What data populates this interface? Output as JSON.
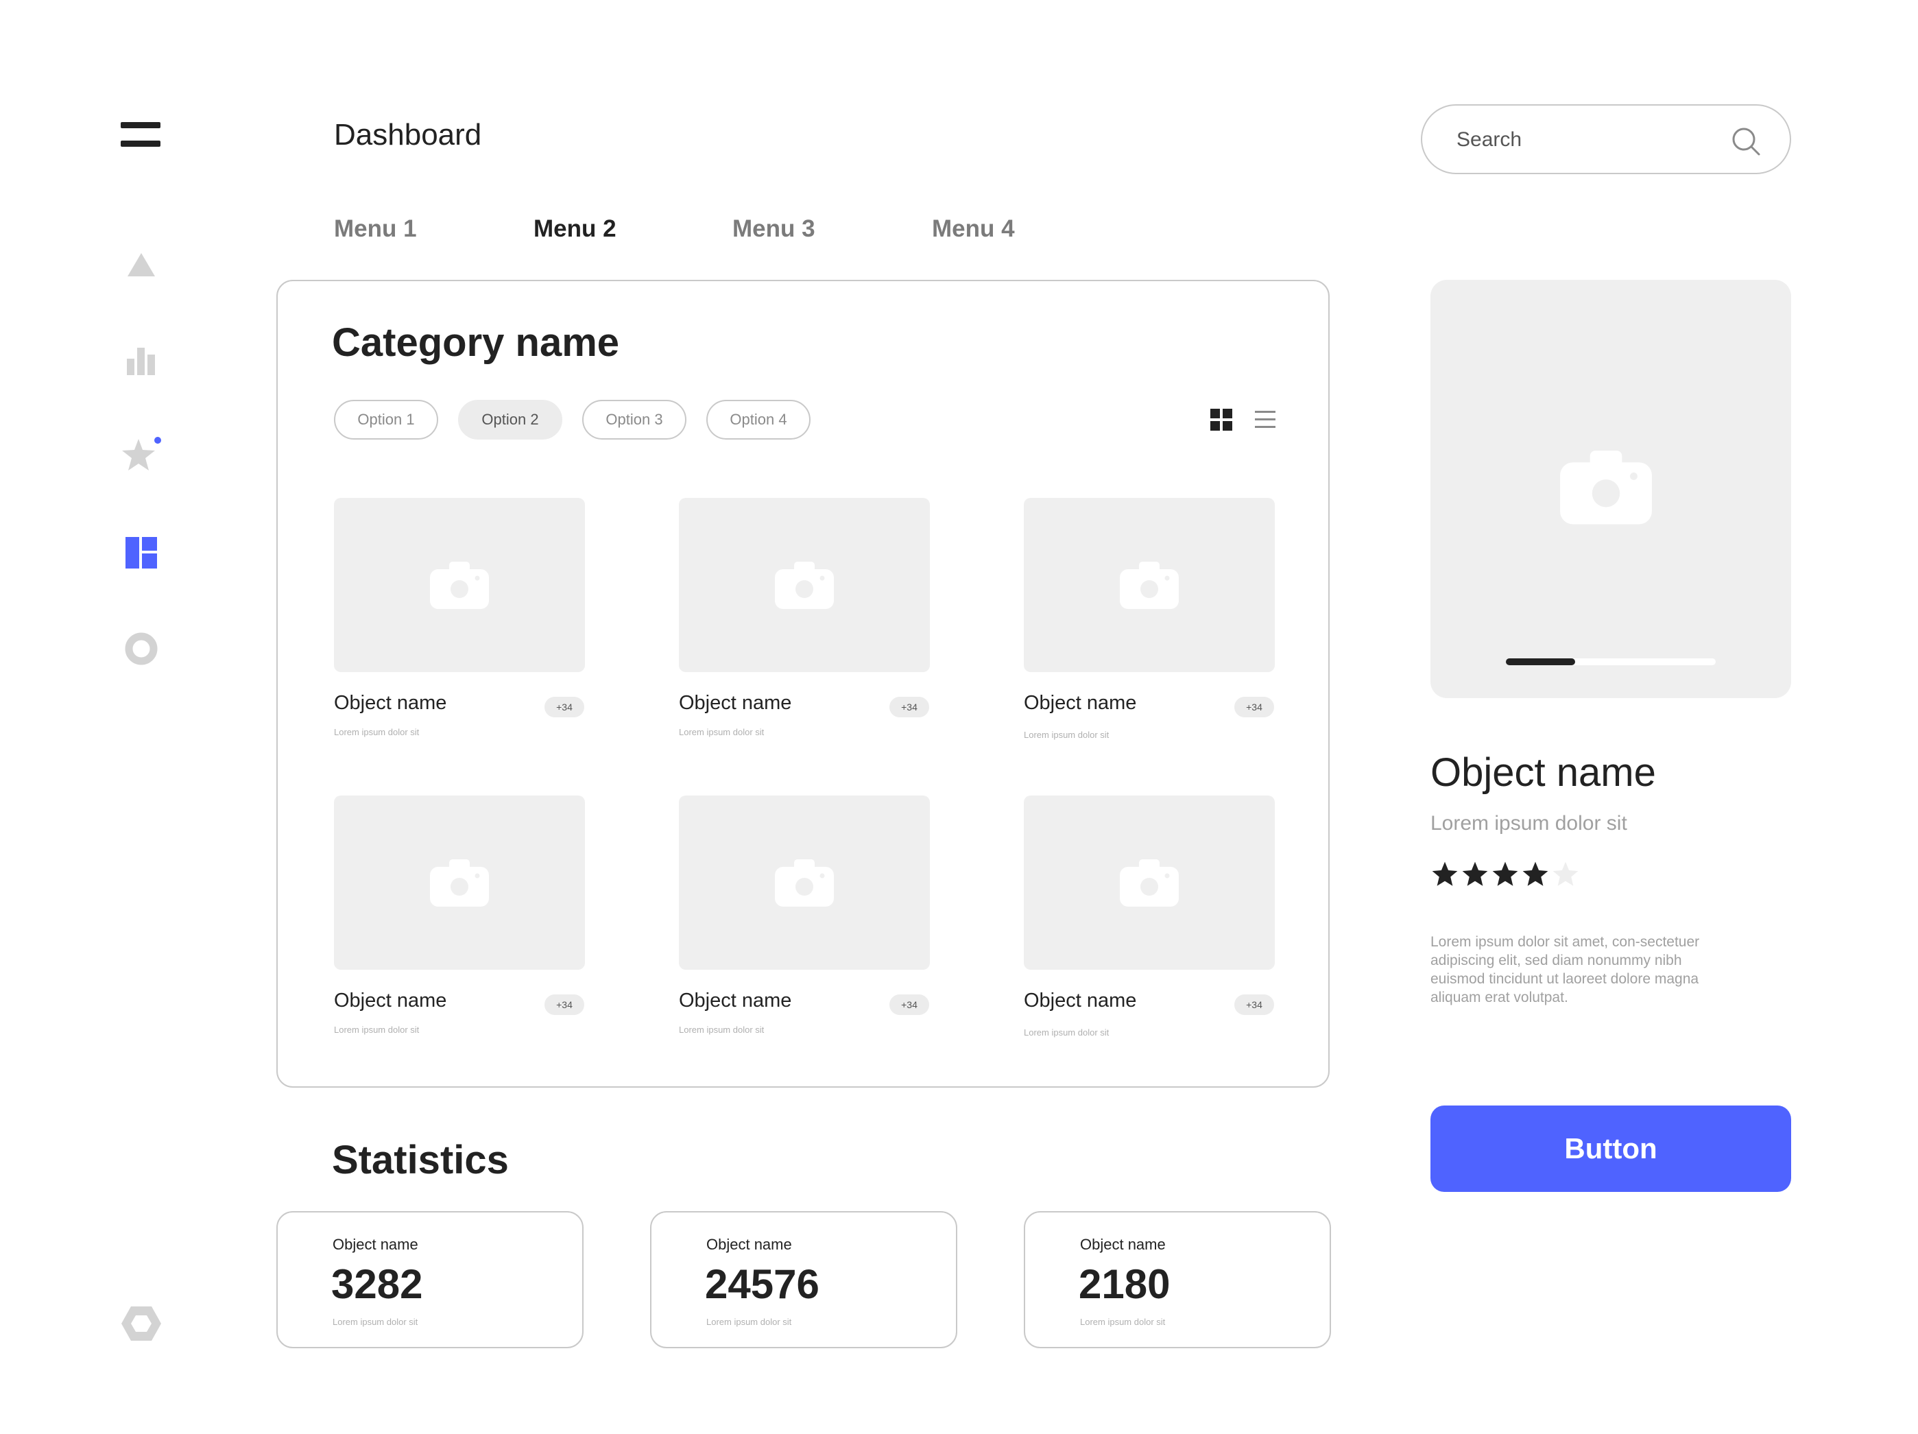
{
  "sidebar": {
    "menu_icon": "hamburger-icon",
    "items": [
      {
        "icon": "triangle-icon",
        "active": false
      },
      {
        "icon": "bar-chart-icon",
        "active": false
      },
      {
        "icon": "star-icon",
        "active": false,
        "notification": true
      },
      {
        "icon": "dashboard-icon",
        "active": true
      },
      {
        "icon": "circle-icon",
        "active": false
      }
    ],
    "bottom_icon": "hexagon-icon"
  },
  "header": {
    "title": "Dashboard",
    "search_placeholder": "Search"
  },
  "tabs": [
    {
      "label": "Menu 1",
      "active": false
    },
    {
      "label": "Menu 2",
      "active": true
    },
    {
      "label": "Menu 3",
      "active": false
    },
    {
      "label": "Menu 4",
      "active": false
    }
  ],
  "category": {
    "title": "Category name",
    "options": [
      {
        "label": "Option 1",
        "active": false
      },
      {
        "label": "Option 2",
        "active": true
      },
      {
        "label": "Option 3",
        "active": false
      },
      {
        "label": "Option 4",
        "active": false
      }
    ],
    "view_modes": [
      "grid-view-icon",
      "list-view-icon"
    ],
    "active_view": "grid",
    "items": [
      {
        "name": "Object name",
        "badge": "+34",
        "subtitle": "Lorem ipsum dolor sit"
      },
      {
        "name": "Object name",
        "badge": "+34",
        "subtitle": "Lorem ipsum dolor sit"
      },
      {
        "name": "Object name",
        "badge": "+34",
        "subtitle": "Lorem ipsum dolor sit"
      },
      {
        "name": "Object name",
        "badge": "+34",
        "subtitle": "Lorem ipsum dolor sit"
      },
      {
        "name": "Object name",
        "badge": "+34",
        "subtitle": "Lorem ipsum dolor sit"
      },
      {
        "name": "Object name",
        "badge": "+34",
        "subtitle": "Lorem ipsum dolor sit"
      }
    ]
  },
  "statistics": {
    "title": "Statistics",
    "cards": [
      {
        "label": "Object name",
        "value": "3282",
        "subtitle": "Lorem ipsum dolor sit"
      },
      {
        "label": "Object name",
        "value": "24576",
        "subtitle": "Lorem ipsum dolor sit"
      },
      {
        "label": "Object name",
        "value": "2180",
        "subtitle": "Lorem ipsum dolor sit"
      }
    ]
  },
  "detail": {
    "image_icon": "camera-icon",
    "carousel_progress": 0.33,
    "name": "Object name",
    "subtitle": "Lorem ipsum dolor sit",
    "rating": 4,
    "rating_max": 5,
    "description": "Lorem ipsum dolor sit amet, con-sectetuer adipiscing elit, sed diam nonummy nibh euismod tincidunt ut laoreet dolore magna aliquam erat volutpat.",
    "button_label": "Button"
  },
  "colors": {
    "accent": "#4f63ff",
    "text": "#222222",
    "muted": "#a0a0a0",
    "placeholder_bg": "#efefef",
    "border": "#c9c9c9",
    "icon_inactive": "#d3d3d3"
  }
}
